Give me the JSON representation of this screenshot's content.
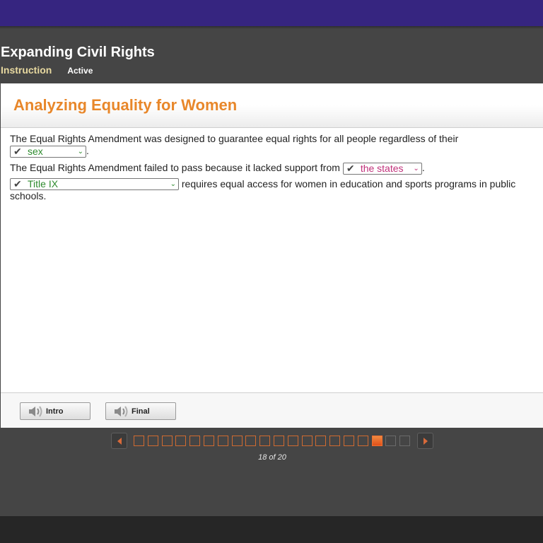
{
  "header": {
    "lesson_title": "Expanding Civil Rights",
    "tabs": [
      {
        "label": "Instruction",
        "state": "selected"
      },
      {
        "label": "Active"
      }
    ]
  },
  "panel": {
    "title": "Analyzing Equality for Women",
    "questions": [
      {
        "before": "The Equal Rights Amendment was designed to guarantee equal rights for all people regardless of their",
        "answer": {
          "check_icon": "✔",
          "value": "sex",
          "status": "correct"
        },
        "after": "."
      },
      {
        "before": "The Equal Rights Amendment failed to pass because it lacked support from",
        "answer": {
          "check_icon": "✔",
          "value": "the states",
          "status": "incorrect"
        },
        "after": "."
      },
      {
        "before": "",
        "answer": {
          "check_icon": "✔",
          "value": "Title IX",
          "status": "correct"
        },
        "after": "requires equal access for women in education and sports programs in public schools."
      }
    ],
    "footer": {
      "buttons": [
        {
          "label": "Intro",
          "icon": "speaker-icon"
        },
        {
          "label": "Final",
          "icon": "speaker-icon"
        }
      ]
    }
  },
  "pager": {
    "current": 18,
    "total": 20,
    "count_text": "18 of 20",
    "chevron_down": "⌄"
  },
  "colors": {
    "topbar": "#362580",
    "title_accent": "#e8872a",
    "correct": "#2e8b2e",
    "incorrect": "#c0307a",
    "page_accent": "#e0501a"
  }
}
